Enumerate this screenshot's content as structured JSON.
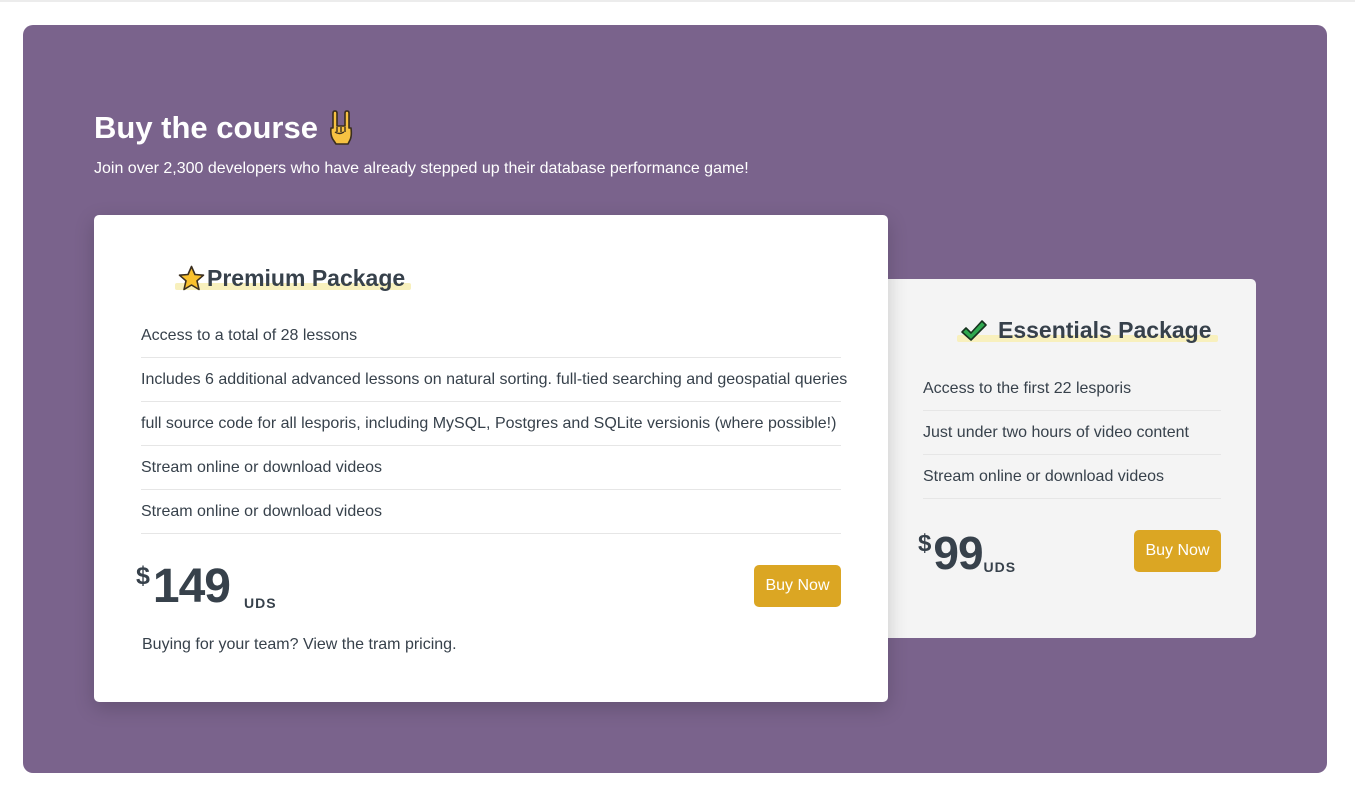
{
  "section": {
    "title": "Buy the course",
    "title_icon": "rock-on-hand-icon",
    "subtitle": "Join over 2,300 developers who have already stepped up their database performance game!",
    "background_color": "#7a638c"
  },
  "premium": {
    "icon": "star-icon",
    "title": "Premium Package",
    "features": [
      "Access to a total of 28 lessons",
      "Includes 6 additional advanced lessons on natural sorting. full-tied searching and geospatial queries",
      "full source code for all lesporis, including MySQL, Postgres and SQLite versionis (where possible!)",
      "Stream online or download videos",
      "Stream online or download videos"
    ],
    "currency_symbol": "$",
    "price": "149",
    "price_unit": "UDS",
    "buy_label": "Buy Now",
    "team_note": "Buying for your team? View the tram pricing."
  },
  "essentials": {
    "icon": "checkmark-icon",
    "title": "Essentials Package",
    "features": [
      "Access to the first 22 lesporis",
      "Just under two hours of video content",
      "Stream online or download videos"
    ],
    "currency_symbol": "$",
    "price": "99",
    "price_unit": "UDS",
    "buy_label": "Buy Now"
  },
  "colors": {
    "button": "#dba623",
    "highlight": "#f8f0bd",
    "text": "#37414b"
  }
}
